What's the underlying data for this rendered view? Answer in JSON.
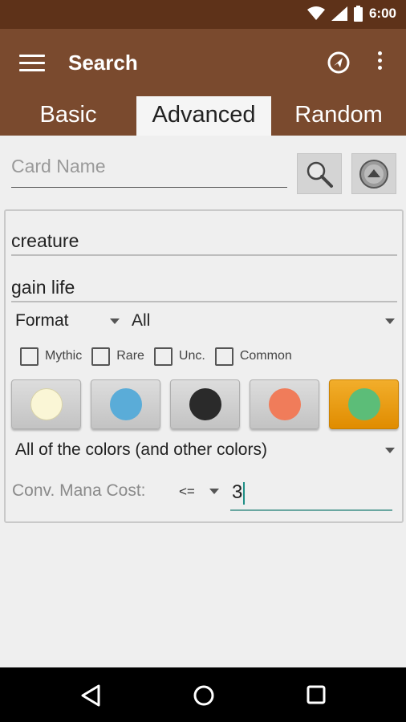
{
  "status_bar": {
    "time": "6:00",
    "icons": [
      "wifi-icon",
      "cell-signal-icon",
      "battery-icon"
    ]
  },
  "app_bar": {
    "title": "Search",
    "menu_icon": "hamburger-menu-icon",
    "action_icon": "compass-icon",
    "overflow_icon": "more-vertical-icon"
  },
  "tabs": [
    {
      "label": "Basic",
      "selected": false
    },
    {
      "label": "Advanced",
      "selected": true
    },
    {
      "label": "Random",
      "selected": false
    }
  ],
  "card_name": {
    "placeholder": "Card Name",
    "value": ""
  },
  "buttons": {
    "search_icon": "magnifier-icon",
    "collapse_icon": "collapse-up-icon"
  },
  "advanced": {
    "type_field": "creature",
    "text_field": "gain life",
    "format_label": "Format",
    "format_value": "All",
    "rarities": [
      {
        "label": "Mythic",
        "checked": false
      },
      {
        "label": "Rare",
        "checked": false
      },
      {
        "label": "Unc.",
        "checked": false
      },
      {
        "label": "Common",
        "checked": false
      }
    ],
    "colors": [
      {
        "name": "white",
        "hex": "#faf6d6",
        "active": false
      },
      {
        "name": "blue",
        "hex": "#5aacd8",
        "active": false
      },
      {
        "name": "black",
        "hex": "#2a2a2a",
        "active": false
      },
      {
        "name": "red",
        "hex": "#f07c5a",
        "active": false
      },
      {
        "name": "green",
        "hex": "#5cbd78",
        "active": true
      }
    ],
    "color_mode": "All of the colors (and other colors)",
    "cmc_label": "Conv. Mana Cost:",
    "cmc_operator": "<=",
    "cmc_value": "3"
  },
  "theme": {
    "primary": "#7a4a2e",
    "status_bar": "#5e3219",
    "accent": "#e8980e",
    "input_accent": "#6aa7a1"
  },
  "nav_bar": [
    "back-icon",
    "home-icon",
    "recents-icon"
  ]
}
